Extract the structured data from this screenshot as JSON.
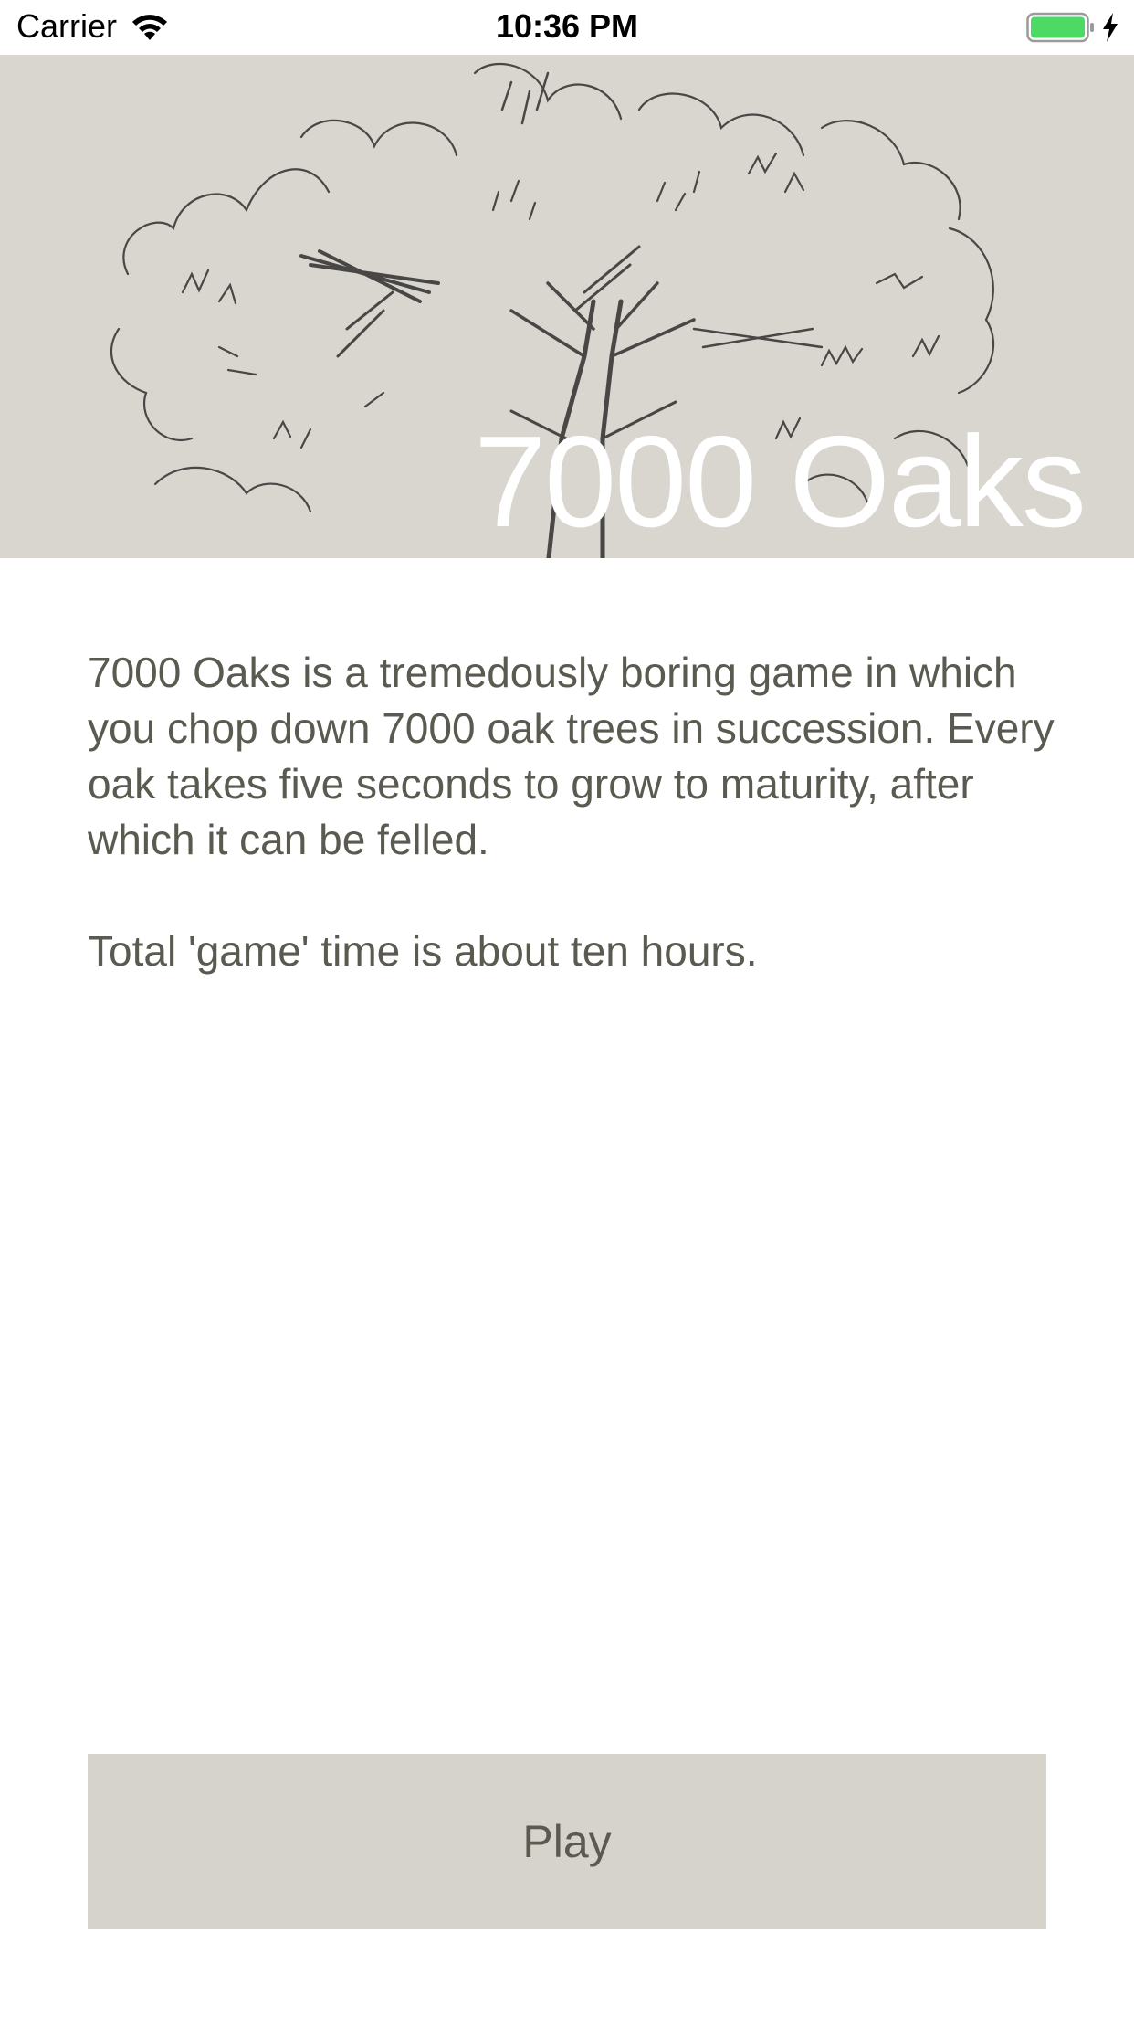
{
  "status_bar": {
    "carrier": "Carrier",
    "time": "10:36 PM",
    "wifi_icon": "wifi-icon",
    "battery_icon": "battery-icon",
    "charging_icon": "lightning-bolt-icon",
    "battery_color": "#4cd964"
  },
  "header": {
    "title": "7000 Oaks",
    "background_color": "#d9d5cf",
    "sketch_ink_color": "#2f2f2f"
  },
  "description": {
    "paragraph_1": "7000 Oaks is a tremedously boring game in which you chop down 7000 oak trees in succession. Every oak takes five seconds to grow to maturity, after which it can be felled.",
    "paragraph_2": "Total 'game' time is about ten hours.",
    "text_color": "#5b5a50"
  },
  "play_button": {
    "label": "Play",
    "background_color": "#d6d2cc"
  }
}
